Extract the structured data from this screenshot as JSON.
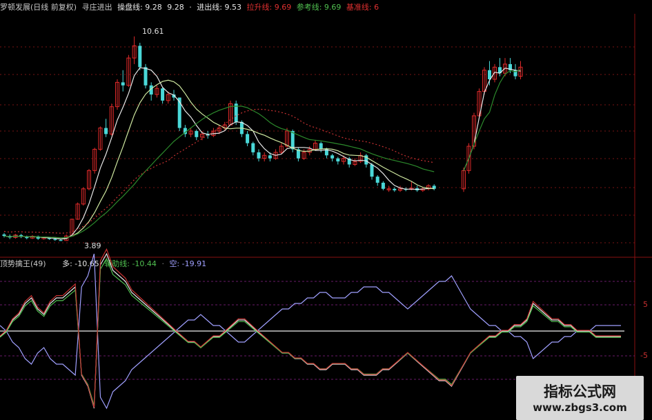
{
  "upper_header": {
    "title": "罗顿发展(日线 前复权)",
    "indicator": "寻庄进出",
    "items": [
      {
        "label": "操盘线: 9.28",
        "color": "#e8e8e8"
      },
      {
        "label": "9.28",
        "color": "#e8e8e8"
      },
      {
        "label": "·",
        "color": "#e8e8e8"
      },
      {
        "label": "进出线: 9.53",
        "color": "#e8e8e8"
      },
      {
        "label": "拉升线: 9.69",
        "color": "#e03030"
      },
      {
        "label": "参考线: 9.69",
        "color": "#50c050"
      },
      {
        "label": "基准线: 6",
        "color": "#e03030"
      }
    ]
  },
  "lower_header": {
    "title": "顶势擒王(49)",
    "items": [
      {
        "label": "多: -10.65",
        "color": "#e8e8e8"
      },
      {
        "label": "辅助线: -10.44",
        "color": "#50c050"
      },
      {
        "label": "·",
        "color": "#888888"
      },
      {
        "label": "空: -19.91",
        "color": "#a0a0ff"
      }
    ]
  },
  "annotations": {
    "high": "10.61",
    "low": "3.89"
  },
  "right_axis": {
    "ticks": [
      "5",
      "-5"
    ]
  },
  "watermark": {
    "line1": "指标公式网",
    "line2": "www.zbgs3.com"
  },
  "chart_data": [
    {
      "type": "candlestick",
      "title": "罗顿发展(日线 前复权)",
      "high_label": 10.61,
      "low_label": 3.89,
      "candles": [
        {
          "o": 4.1,
          "c": 4.05,
          "h": 4.15,
          "l": 4.0
        },
        {
          "o": 4.05,
          "c": 4.0,
          "h": 4.1,
          "l": 3.95
        },
        {
          "o": 4.0,
          "c": 4.08,
          "h": 4.12,
          "l": 3.96
        },
        {
          "o": 4.08,
          "c": 4.02,
          "h": 4.12,
          "l": 3.98
        },
        {
          "o": 4.02,
          "c": 3.98,
          "h": 4.06,
          "l": 3.94
        },
        {
          "o": 3.98,
          "c": 4.04,
          "h": 4.08,
          "l": 3.95
        },
        {
          "o": 4.04,
          "c": 3.96,
          "h": 4.06,
          "l": 3.92
        },
        {
          "o": 3.96,
          "c": 4.0,
          "h": 4.03,
          "l": 3.93
        },
        {
          "o": 4.0,
          "c": 3.95,
          "h": 4.02,
          "l": 3.92
        },
        {
          "o": 3.95,
          "c": 3.92,
          "h": 3.98,
          "l": 3.89
        },
        {
          "o": 3.92,
          "c": 3.9,
          "h": 3.94,
          "l": 3.89
        },
        {
          "o": 3.9,
          "c": 4.05,
          "h": 4.1,
          "l": 3.89
        },
        {
          "o": 4.05,
          "c": 4.6,
          "h": 4.62,
          "l": 4.05
        },
        {
          "o": 4.6,
          "c": 5.1,
          "h": 5.15,
          "l": 4.58
        },
        {
          "o": 5.1,
          "c": 5.6,
          "h": 5.65,
          "l": 5.05
        },
        {
          "o": 5.6,
          "c": 6.2,
          "h": 6.25,
          "l": 5.55
        },
        {
          "o": 6.2,
          "c": 6.9,
          "h": 6.95,
          "l": 6.1
        },
        {
          "o": 6.9,
          "c": 7.6,
          "h": 7.65,
          "l": 6.85
        },
        {
          "o": 7.6,
          "c": 7.4,
          "h": 7.9,
          "l": 7.3
        },
        {
          "o": 7.4,
          "c": 8.3,
          "h": 8.4,
          "l": 7.35
        },
        {
          "o": 8.3,
          "c": 9.1,
          "h": 9.2,
          "l": 8.2
        },
        {
          "o": 9.1,
          "c": 9.0,
          "h": 9.5,
          "l": 8.8
        },
        {
          "o": 9.0,
          "c": 9.9,
          "h": 10.0,
          "l": 8.95
        },
        {
          "o": 9.9,
          "c": 10.3,
          "h": 10.61,
          "l": 9.7
        },
        {
          "o": 10.3,
          "c": 9.6,
          "h": 10.4,
          "l": 9.5
        },
        {
          "o": 9.6,
          "c": 9.0,
          "h": 9.7,
          "l": 8.9
        },
        {
          "o": 9.0,
          "c": 8.7,
          "h": 9.1,
          "l": 8.5
        },
        {
          "o": 8.7,
          "c": 8.9,
          "h": 9.0,
          "l": 8.6
        },
        {
          "o": 8.9,
          "c": 8.5,
          "h": 8.95,
          "l": 8.4
        },
        {
          "o": 8.5,
          "c": 8.7,
          "h": 8.8,
          "l": 8.4
        },
        {
          "o": 8.7,
          "c": 8.6,
          "h": 8.85,
          "l": 8.5
        },
        {
          "o": 8.6,
          "c": 7.6,
          "h": 8.6,
          "l": 7.5
        },
        {
          "o": 7.6,
          "c": 7.4,
          "h": 7.7,
          "l": 7.3
        },
        {
          "o": 7.4,
          "c": 7.5,
          "h": 7.6,
          "l": 7.3
        },
        {
          "o": 7.5,
          "c": 7.3,
          "h": 7.55,
          "l": 7.2
        },
        {
          "o": 7.3,
          "c": 7.4,
          "h": 7.5,
          "l": 7.2
        },
        {
          "o": 7.4,
          "c": 7.35,
          "h": 7.5,
          "l": 7.25
        },
        {
          "o": 7.35,
          "c": 7.5,
          "h": 7.6,
          "l": 7.3
        },
        {
          "o": 7.5,
          "c": 7.6,
          "h": 7.7,
          "l": 7.4
        },
        {
          "o": 7.6,
          "c": 7.7,
          "h": 7.8,
          "l": 7.5
        },
        {
          "o": 7.7,
          "c": 8.4,
          "h": 8.5,
          "l": 7.7
        },
        {
          "o": 8.4,
          "c": 7.8,
          "h": 8.5,
          "l": 7.7
        },
        {
          "o": 7.8,
          "c": 7.4,
          "h": 7.85,
          "l": 7.3
        },
        {
          "o": 7.4,
          "c": 7.1,
          "h": 7.5,
          "l": 7.0
        },
        {
          "o": 7.1,
          "c": 6.8,
          "h": 7.15,
          "l": 6.7
        },
        {
          "o": 6.8,
          "c": 6.6,
          "h": 6.9,
          "l": 6.5
        },
        {
          "o": 6.6,
          "c": 6.7,
          "h": 6.8,
          "l": 6.5
        },
        {
          "o": 6.7,
          "c": 6.6,
          "h": 6.8,
          "l": 6.5
        },
        {
          "o": 6.6,
          "c": 6.8,
          "h": 6.9,
          "l": 6.55
        },
        {
          "o": 6.8,
          "c": 7.0,
          "h": 7.1,
          "l": 6.75
        },
        {
          "o": 7.0,
          "c": 7.5,
          "h": 7.6,
          "l": 6.95
        },
        {
          "o": 7.5,
          "c": 6.9,
          "h": 7.55,
          "l": 6.8
        },
        {
          "o": 6.9,
          "c": 6.6,
          "h": 6.95,
          "l": 6.5
        },
        {
          "o": 6.6,
          "c": 6.8,
          "h": 6.9,
          "l": 6.55
        },
        {
          "o": 6.8,
          "c": 6.9,
          "h": 7.0,
          "l": 6.7
        },
        {
          "o": 6.9,
          "c": 7.1,
          "h": 7.2,
          "l": 6.85
        },
        {
          "o": 7.1,
          "c": 6.9,
          "h": 7.15,
          "l": 6.8
        },
        {
          "o": 6.9,
          "c": 6.7,
          "h": 6.95,
          "l": 6.6
        },
        {
          "o": 6.7,
          "c": 6.6,
          "h": 6.75,
          "l": 6.5
        },
        {
          "o": 6.6,
          "c": 6.5,
          "h": 6.65,
          "l": 6.4
        },
        {
          "o": 6.5,
          "c": 6.6,
          "h": 6.7,
          "l": 6.4
        },
        {
          "o": 6.6,
          "c": 6.4,
          "h": 6.65,
          "l": 6.3
        },
        {
          "o": 6.4,
          "c": 6.5,
          "h": 6.6,
          "l": 6.35
        },
        {
          "o": 6.5,
          "c": 6.7,
          "h": 6.8,
          "l": 6.45
        },
        {
          "o": 6.7,
          "c": 6.4,
          "h": 6.75,
          "l": 6.3
        },
        {
          "o": 6.4,
          "c": 6.0,
          "h": 6.45,
          "l": 5.9
        },
        {
          "o": 6.0,
          "c": 5.8,
          "h": 6.05,
          "l": 5.7
        },
        {
          "o": 5.8,
          "c": 5.6,
          "h": 5.85,
          "l": 5.55
        },
        {
          "o": 5.6,
          "c": 5.6,
          "h": 5.7,
          "l": 5.5
        },
        {
          "o": 5.6,
          "c": 5.55,
          "h": 5.65,
          "l": 5.5
        },
        {
          "o": 5.55,
          "c": 5.6,
          "h": 5.7,
          "l": 5.5
        },
        {
          "o": 5.6,
          "c": 5.58,
          "h": 5.65,
          "l": 5.52
        },
        {
          "o": 5.58,
          "c": 5.62,
          "h": 5.85,
          "l": 5.55
        },
        {
          "o": 5.62,
          "c": 5.55,
          "h": 5.7,
          "l": 5.5
        },
        {
          "o": 5.55,
          "c": 5.6,
          "h": 5.65,
          "l": 5.5
        },
        {
          "o": 5.6,
          "c": 5.7,
          "h": 5.75,
          "l": 5.55
        },
        {
          "o": 5.7,
          "c": 5.6,
          "h": 5.75,
          "l": 5.55
        }
      ],
      "candles2": [
        {
          "o": 5.6,
          "c": 6.2,
          "h": 6.3,
          "l": 5.5
        },
        {
          "o": 6.2,
          "c": 7.0,
          "h": 7.1,
          "l": 6.1
        },
        {
          "o": 7.0,
          "c": 8.0,
          "h": 8.1,
          "l": 6.9
        },
        {
          "o": 8.0,
          "c": 8.8,
          "h": 8.9,
          "l": 7.9
        },
        {
          "o": 8.8,
          "c": 9.5,
          "h": 9.6,
          "l": 8.7
        },
        {
          "o": 9.5,
          "c": 9.2,
          "h": 9.8,
          "l": 9.0
        },
        {
          "o": 9.2,
          "c": 9.6,
          "h": 9.7,
          "l": 9.1
        },
        {
          "o": 9.6,
          "c": 9.4,
          "h": 9.9,
          "l": 9.3
        },
        {
          "o": 9.4,
          "c": 9.7,
          "h": 9.9,
          "l": 9.3
        },
        {
          "o": 9.7,
          "c": 9.5,
          "h": 9.9,
          "l": 9.4
        },
        {
          "o": 9.5,
          "c": 9.3,
          "h": 9.7,
          "l": 9.2
        },
        {
          "o": 9.3,
          "c": 9.6,
          "h": 9.8,
          "l": 9.2
        }
      ]
    },
    {
      "type": "line",
      "title": "顶势擒王(49)",
      "zero_line": 0,
      "reference_lines": [
        5,
        -5
      ],
      "series": [
        {
          "name": "多",
          "color": "#e8e8e8"
        },
        {
          "name": "辅助线",
          "color": "#50c050"
        },
        {
          "name": "空",
          "color": "#a0a0ff"
        }
      ],
      "values_duo": [
        -1,
        0,
        2,
        3,
        5,
        6,
        4,
        3,
        5,
        6,
        6,
        7,
        8,
        -8,
        -10,
        -14,
        12,
        14,
        11,
        10,
        9,
        7,
        6,
        5,
        4,
        3,
        2,
        1,
        0,
        -1,
        -2,
        -2,
        -3,
        -2,
        -1,
        -1,
        0,
        1,
        2,
        2,
        1,
        0,
        -1,
        -2,
        -3,
        -4,
        -4,
        -5,
        -5,
        -6,
        -6,
        -7,
        -7,
        -6,
        -6,
        -6,
        -7,
        -7,
        -8,
        -8,
        -8,
        -7,
        -7,
        -6,
        -5,
        -4,
        -5,
        -6,
        -7,
        -8,
        -9,
        -9,
        -10,
        -8,
        -6,
        -4,
        -3,
        -2,
        -1,
        -1,
        0,
        0,
        1,
        1,
        2,
        5,
        4,
        3,
        2,
        2,
        1,
        1,
        0,
        0,
        0,
        -1,
        -1,
        -1,
        -1,
        -1
      ],
      "values_kong": [
        1,
        0,
        -2,
        -3,
        -5,
        -6,
        -4,
        -3,
        -5,
        -6,
        -6,
        -7,
        -8,
        8,
        10,
        14,
        -12,
        -14,
        -11,
        -10,
        -9,
        -7,
        -6,
        -5,
        -4,
        -3,
        -2,
        -1,
        0,
        1,
        2,
        2,
        3,
        2,
        1,
        1,
        0,
        -1,
        -2,
        -2,
        -1,
        0,
        1,
        2,
        3,
        4,
        4,
        5,
        5,
        6,
        6,
        7,
        7,
        6,
        6,
        6,
        7,
        7,
        8,
        8,
        8,
        7,
        7,
        6,
        5,
        4,
        5,
        6,
        7,
        8,
        9,
        9,
        10,
        8,
        6,
        4,
        3,
        2,
        1,
        1,
        0,
        0,
        -1,
        -1,
        -2,
        -5,
        -4,
        -3,
        -2,
        -2,
        -1,
        -1,
        0,
        0,
        0,
        1,
        1,
        1,
        1,
        1
      ]
    }
  ]
}
